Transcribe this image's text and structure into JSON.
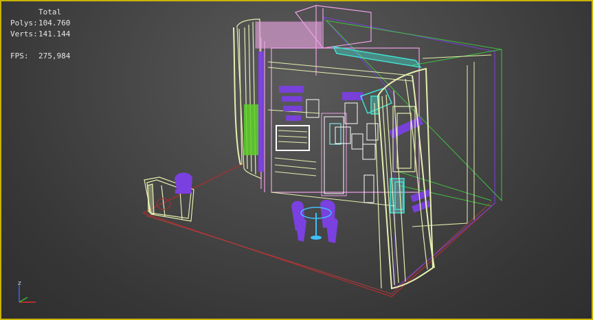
{
  "stats": {
    "column_header": "Total",
    "polys_label": "Polys:",
    "polys_value": "104.760",
    "verts_label": "Verts:",
    "verts_value": "141.144",
    "fps_label": "FPS:",
    "fps_value": "275,984"
  },
  "gizmo": {
    "z_label": "z"
  },
  "colors": {
    "viewport_border": "#c8b400",
    "wire_cream": "#e8f0b0",
    "wire_pink": "#f0a0e8",
    "wire_green": "#40c040",
    "wire_teal": "#40e0d0",
    "wire_purple": "#7a40e0",
    "floor_red": "#a03030"
  }
}
